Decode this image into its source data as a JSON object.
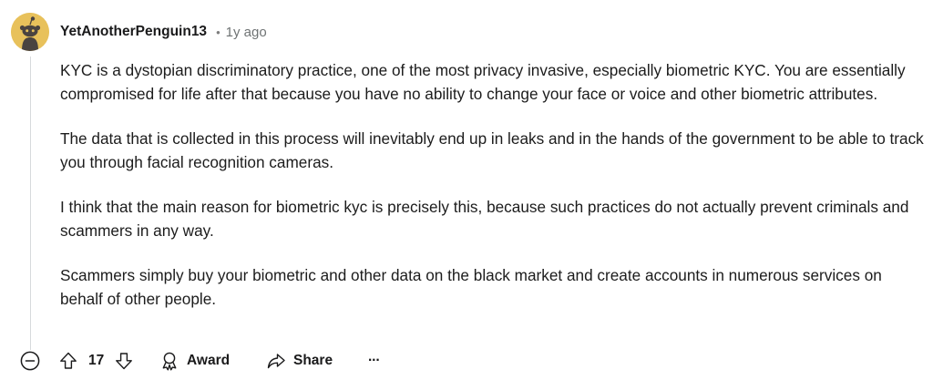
{
  "comment": {
    "author": "YetAnotherPenguin13",
    "age": "1y ago",
    "paragraphs": [
      "KYC is a dystopian discriminatory practice, one of the most privacy invasive, especially biometric KYC. You are essentially compromised for life after that because you have no ability to change your face or voice and other biometric attributes.",
      "The data that is collected in this process will inevitably end up in leaks and in the hands of the government to be able to track you through facial recognition cameras.",
      "I think that the main reason for biometric kyc is precisely this, because such practices do not actually prevent criminals and scammers in any way.",
      "Scammers simply buy your biometric and other data on the black market and create accounts in numerous services on behalf of other people."
    ]
  },
  "actions": {
    "vote_count": "17",
    "award_label": "Award",
    "share_label": "Share",
    "more_label": "···"
  },
  "icons": {
    "collapse": "minus-circle-icon",
    "upvote": "arrow-up-icon",
    "downvote": "arrow-down-icon",
    "award": "award-icon",
    "share": "share-icon",
    "more": "more-horizontal-icon",
    "avatar": "snoo-avatar-icon"
  },
  "colors": {
    "avatar_bg": "#e8c15b",
    "text": "#1a1a1b",
    "muted": "#6f7374",
    "thread_line": "#d7dadc"
  }
}
